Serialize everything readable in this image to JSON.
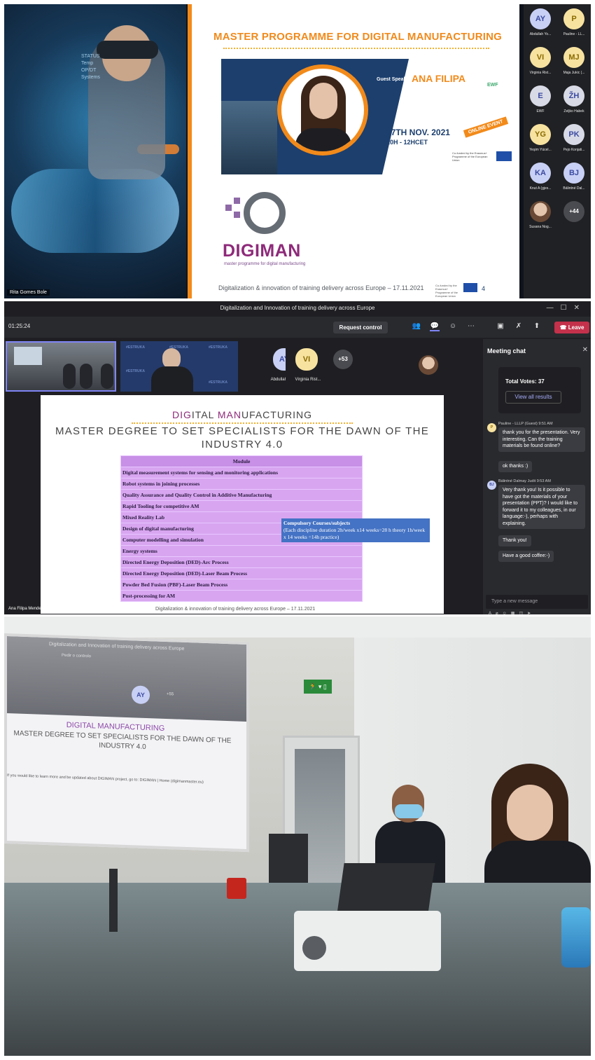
{
  "panel1": {
    "hero_name_tag": "Rita Gomes Bole",
    "hero_hud": [
      "STATUS",
      "Temp",
      "OP/DT",
      "Systems"
    ],
    "slide": {
      "title": "MASTER PROGRAMME FOR DIGITAL MANUFACTURING",
      "guest_label": "Guest Speaker:",
      "guest_name": "ANA FILIPA",
      "date": "17TH NOV. 2021",
      "time": "10H - 12HCET",
      "online_tag": "ONLINE EVENT",
      "ewf": "EWF",
      "cofunded": "Co-funded by the Erasmus+ Programme of the European Union",
      "logo_name": "DIGIMAN",
      "logo_sub": "master programme for digital manufacturing",
      "footer": "Digitalization & innovation of training delivery across Europe – 17.11.2021",
      "page": "4"
    },
    "participants": [
      {
        "initials": "AY",
        "name": "Abdullah Yo...",
        "style": "blue"
      },
      {
        "initials": "P",
        "name": "Pauline - LL...",
        "style": "yellow"
      },
      {
        "initials": "VI",
        "name": "Virginia Rist...",
        "style": "yellow"
      },
      {
        "initials": "MJ",
        "name": "Maja Jukic (...",
        "style": "yellow"
      },
      {
        "initials": "E",
        "name": "EWF",
        "style": "gray"
      },
      {
        "initials": "ŽH",
        "name": "Željko Habek",
        "style": "gray"
      },
      {
        "initials": "YG",
        "name": "Yeşim Yücel...",
        "style": "yellow"
      },
      {
        "initials": "PK",
        "name": "Pejo Konjati...",
        "style": "gray"
      },
      {
        "initials": "KA",
        "name": "Knut A (gjes...",
        "style": "blue"
      },
      {
        "initials": "BJ",
        "name": "Bálintné Dal...",
        "style": "blue"
      },
      {
        "initials": "",
        "name": "Susana Nog...",
        "style": "photo"
      },
      {
        "initials": "+44",
        "name": "",
        "style": "more"
      }
    ]
  },
  "panel2": {
    "window_title": "Digitalization and Innovation of training delivery across Europe",
    "timer": "01:25:24",
    "request_control": "Request control",
    "leave": "Leave",
    "strip": {
      "av1": {
        "initials": "AY",
        "name": "Abdullah Ya..."
      },
      "av2": {
        "initials": "VI",
        "name": "Virginia Rist..."
      },
      "more": "+53",
      "hash": "#ESTRUKA"
    },
    "slide": {
      "title_a": "DIG",
      "title_b": "ITAL ",
      "title_c": "MAN",
      "title_d": "UFACTURING",
      "subtitle": "MASTER DEGREE TO SET SPECIALISTS FOR THE DAWN OF THE INDUSTRY 4.0",
      "table_header": "Module",
      "modules": [
        "Digital measurement systems for sensing and monitoring applications",
        "Robot systems in joining processes",
        "Quality Assurance and Quality Control in Additive Manufacturing",
        "Rapid Tooling for competitive AM",
        "Mixed Reality Lab",
        "Design of digital manufacturing",
        "Computer modelling and simulation",
        "Energy systems",
        "Directed Energy Deposition (DED)-Arc Process",
        "Directed Energy Deposition (DED)-Laser Beam Process",
        "Powder Bed Fusion (PBF)-Laser Beam Process",
        "Post-processing for AM"
      ],
      "callout_title": "Compulsory Courses/subjects",
      "callout_body": "(Each discipline duration 2h/week x14 weeks=28 h theory 1h/week x 14 weeks =14h practice)",
      "footer": "Digitalization & innovation of training delivery across Europe – 17.11.2021"
    },
    "presenter": "Ana Filipa Mendes",
    "chat": {
      "header": "Meeting chat",
      "total_votes": "Total Votes: 37",
      "view_results": "View all results",
      "m1": {
        "initial": "P",
        "meta": "Pauline - LLLP (Guest)   9:51 AM",
        "text": "thank you for the presentation. Very interesting. Can the training materials be found online?",
        "reply": "ok thanks :)"
      },
      "m2": {
        "initial": "BJ",
        "meta": "Bálintné Dalmay Judit   9:53 AM",
        "text": "Very thank you! Is it possible to have got the materials of your presentation (PPT)? I would like to forward it to my colleagues, in our language:-), perhaps with explaining.",
        "reply1": "Thank you!",
        "reply2": "Have a good coffee:-)"
      },
      "placeholder": "Type a new message"
    }
  },
  "panel3": {
    "screen_title": "Digitalization and Innovation of training delivery across Europe",
    "screen_button": "Pedir o controlo",
    "screen_avatar": "AY",
    "screen_more": "+55",
    "slide_title": "DIGITAL MANUFACTURING",
    "slide_sub": "MASTER DEGREE TO SET SPECIALISTS FOR THE DAWN OF THE INDUSTRY 4.0",
    "slide_line": "If you would like to learn more and be updated about DIGIMAN project, go to: DIGIMAN | Home (digimanmaster.eu)"
  },
  "colors": {
    "orange": "#f28a1a",
    "purple": "#8e2a7a",
    "teams_red": "#c4314b",
    "module_bg": "#d8a6f0",
    "callout": "#4472c4"
  }
}
